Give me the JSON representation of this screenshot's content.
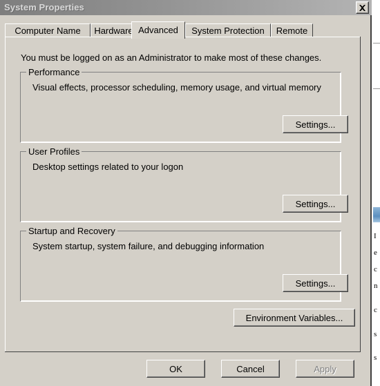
{
  "window": {
    "title": "System Properties",
    "close_icon": "close-icon"
  },
  "tabs": [
    {
      "label": "Computer Name",
      "selected": false
    },
    {
      "label": "Hardware",
      "selected": false
    },
    {
      "label": "Advanced",
      "selected": true
    },
    {
      "label": "System Protection",
      "selected": false
    },
    {
      "label": "Remote",
      "selected": false
    }
  ],
  "panel": {
    "admin_note": "You must be logged on as an Administrator to make most of these changes.",
    "groups": [
      {
        "title": "Performance",
        "description": "Visual effects, processor scheduling, memory usage, and virtual memory",
        "button_label": "Settings..."
      },
      {
        "title": "User Profiles",
        "description": "Desktop settings related to your logon",
        "button_label": "Settings..."
      },
      {
        "title": "Startup and Recovery",
        "description": "System startup, system failure, and debugging information",
        "button_label": "Settings..."
      }
    ],
    "environment_variables_label": "Environment Variables..."
  },
  "footer": {
    "ok_label": "OK",
    "cancel_label": "Cancel",
    "apply_label": "Apply",
    "apply_enabled": false
  },
  "colors": {
    "dialog_face": "#d4d0c8",
    "title_bar_start": "#7e7e7e",
    "title_bar_end": "#b4b4b4",
    "title_text": "#d8d8d8",
    "text": "#000000",
    "disabled_text": "#808080"
  }
}
